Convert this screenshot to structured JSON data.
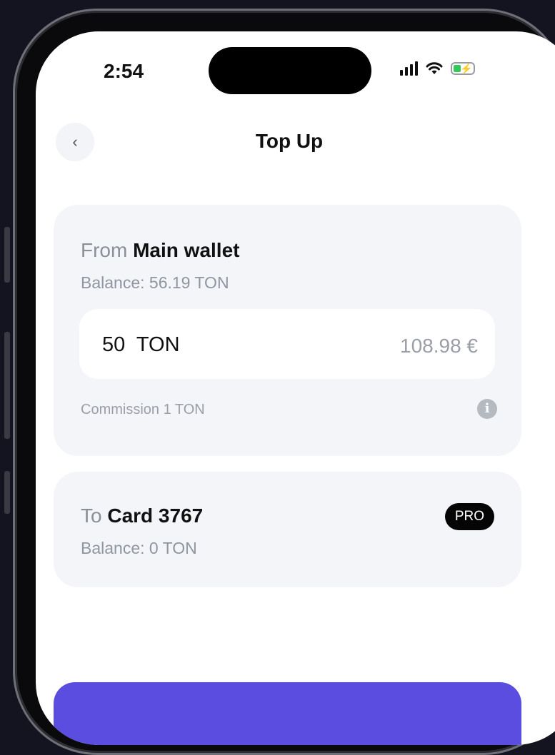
{
  "status_bar": {
    "time": "2:54"
  },
  "header": {
    "title": "Top Up",
    "back_icon": "chevron-left-icon"
  },
  "from_card": {
    "prefix": "From",
    "wallet_name": "Main wallet",
    "balance": "Balance: 56.19 TON",
    "amount": "50  TON",
    "fiat_value": "108.98 €",
    "commission": "Commission 1 TON",
    "info_icon": "info-icon"
  },
  "to_card": {
    "prefix": "To",
    "card_name": "Card 3767",
    "balance": "Balance: 0 TON",
    "badge": "PRO"
  },
  "colors": {
    "accent": "#5b4de0",
    "card_bg": "#f3f5f8",
    "badge_bg": "#050505",
    "battery_fill": "#34c759"
  }
}
